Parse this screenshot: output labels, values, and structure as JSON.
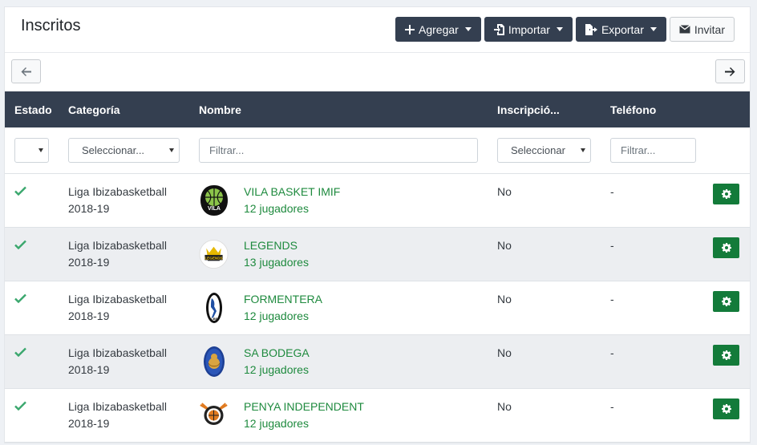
{
  "header": {
    "title": "Inscritos",
    "add_label": "Agregar",
    "import_label": "Importar",
    "export_label": "Exportar",
    "invite_label": "Invitar"
  },
  "table": {
    "columns": {
      "estado": "Estado",
      "categoria": "Categoría",
      "nombre": "Nombre",
      "inscripcion": "Inscripció...",
      "telefono": "Teléfono"
    },
    "filters": {
      "estado": "",
      "categoria": "Seleccionar...",
      "nombre_placeholder": "Filtrar...",
      "inscripcion": "Seleccionar",
      "telefono_placeholder": "Filtrar..."
    },
    "rows": [
      {
        "category_line1": "Liga Ibizabasketball",
        "category_line2": "2018-19",
        "name": "VILA BASKET IMIF",
        "players": "12 jugadores",
        "inscription": "No",
        "phone": "-"
      },
      {
        "category_line1": "Liga Ibizabasketball",
        "category_line2": "2018-19",
        "name": "LEGENDS",
        "players": "13 jugadores",
        "inscription": "No",
        "phone": "-"
      },
      {
        "category_line1": "Liga Ibizabasketball",
        "category_line2": "2018-19",
        "name": "FORMENTERA",
        "players": "12 jugadores",
        "inscription": "No",
        "phone": "-"
      },
      {
        "category_line1": "Liga Ibizabasketball",
        "category_line2": "2018-19",
        "name": "SA BODEGA",
        "players": "12 jugadores",
        "inscription": "No",
        "phone": "-"
      },
      {
        "category_line1": "Liga Ibizabasketball",
        "category_line2": "2018-19",
        "name": "PENYA INDEPENDENT",
        "players": "12 jugadores",
        "inscription": "No",
        "phone": "-"
      }
    ]
  },
  "logos": {
    "vila": "VILA",
    "legends": "LEGENDS",
    "formentera": "CBF"
  },
  "icons": {
    "add": "plus-icon",
    "import": "import-icon",
    "export": "export-icon",
    "invite": "envelope-icon",
    "prev": "arrow-left-icon",
    "next": "arrow-right-icon",
    "status": "check-icon",
    "action": "gear-icon"
  },
  "colors": {
    "header_bg": "#343f50",
    "accent_green": "#1e8a3e",
    "action_green": "#137b3a",
    "check_green": "#3aa76d"
  }
}
